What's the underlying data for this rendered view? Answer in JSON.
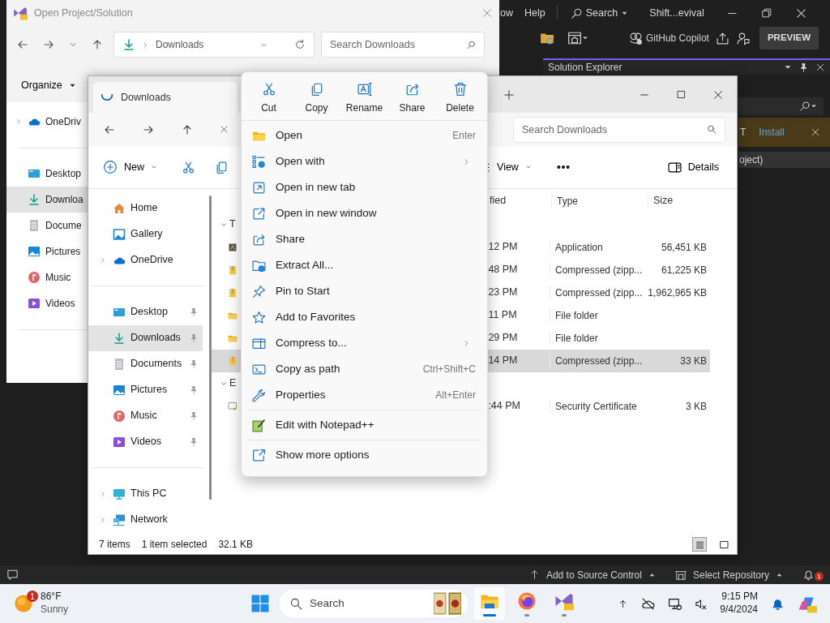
{
  "ide": {
    "menu": [
      {
        "label": "ow"
      },
      {
        "label": "Help"
      }
    ],
    "search": "Search",
    "title": "Shift...evival",
    "copilot": "GitHub Copilot",
    "preview": "PREVIEW",
    "solution_explorer": {
      "title": "Solution Explorer",
      "info_text": "T",
      "info_action": "Install",
      "tree_item": "oject)"
    },
    "status_bar": {
      "source_control": "Add to Source Control",
      "repository": "Select Repository",
      "notifications": "1"
    }
  },
  "dialog": {
    "title": "Open Project/Solution",
    "address": "Downloads",
    "search": {
      "placeholder": "Search Downloads"
    },
    "organize": "Organize",
    "nav": [
      [
        {
          "label": "OneDriv",
          "expandable": true,
          "selected": false
        }
      ],
      [
        {
          "label": "Desktop",
          "expandable": false,
          "selected": false
        },
        {
          "label": "Downloa",
          "expandable": false,
          "selected": true
        },
        {
          "label": "Docume",
          "expandable": false,
          "selected": false
        },
        {
          "label": "Pictures",
          "expandable": false,
          "selected": false
        },
        {
          "label": "Music",
          "expandable": false,
          "selected": false
        },
        {
          "label": "Videos",
          "expandable": false,
          "selected": false
        }
      ]
    ]
  },
  "explorer": {
    "tab": "Downloads",
    "search": {
      "placeholder": "Search Downloads"
    },
    "commands": {
      "new": "New",
      "view": "View",
      "details": "Details"
    },
    "sidebar": [
      [
        {
          "label": "Home",
          "expandable": false,
          "pinned": false,
          "selected": false
        },
        {
          "label": "Gallery",
          "expandable": false,
          "pinned": false,
          "selected": false
        },
        {
          "label": "OneDrive",
          "expandable": true,
          "pinned": false,
          "selected": false
        }
      ],
      [
        {
          "label": "Desktop",
          "expandable": false,
          "pinned": true,
          "selected": false
        },
        {
          "label": "Downloads",
          "expandable": false,
          "pinned": true,
          "selected": true
        },
        {
          "label": "Documents",
          "expandable": false,
          "pinned": true,
          "selected": false
        },
        {
          "label": "Pictures",
          "expandable": false,
          "pinned": true,
          "selected": false
        },
        {
          "label": "Music",
          "expandable": false,
          "pinned": true,
          "selected": false
        },
        {
          "label": "Videos",
          "expandable": false,
          "pinned": true,
          "selected": false
        }
      ],
      [
        {
          "label": "This PC",
          "expandable": true,
          "pinned": false,
          "selected": false
        },
        {
          "label": "Network",
          "expandable": true,
          "pinned": false,
          "selected": false
        }
      ]
    ],
    "columns": [
      "fied",
      "Type",
      "Size"
    ],
    "groups": [
      {
        "label": "T",
        "expanded": true,
        "rows": [
          {
            "modified": "12 PM",
            "type": "Application",
            "size": "56,451 KB",
            "selected": false
          },
          {
            "modified": "48 PM",
            "type": "Compressed (zipp...",
            "size": "61,225 KB",
            "selected": false
          },
          {
            "modified": "23 PM",
            "type": "Compressed (zipp...",
            "size": "1,962,965 KB",
            "selected": false
          },
          {
            "modified": "11 PM",
            "type": "File folder",
            "size": "",
            "selected": false
          },
          {
            "modified": "29 PM",
            "type": "File folder",
            "size": "",
            "selected": false
          },
          {
            "modified": "14 PM",
            "type": "Compressed (zipp...",
            "size": "33 KB",
            "selected": true
          }
        ]
      },
      {
        "label": "E",
        "expanded": true,
        "rows": [
          {
            "modified": ":44 PM",
            "type": "Security Certificate",
            "size": "3 KB",
            "selected": false
          }
        ]
      }
    ],
    "status": {
      "count": "7 items",
      "selection": "1 item selected",
      "size": "32.1 KB"
    },
    "views": [
      {
        "selected": true
      },
      {
        "selected": false
      }
    ]
  },
  "context_menu": {
    "actions": [
      {
        "label": "Cut"
      },
      {
        "label": "Copy"
      },
      {
        "label": "Rename"
      },
      {
        "label": "Share"
      },
      {
        "label": "Delete"
      }
    ],
    "sections": [
      [
        {
          "label": "Open",
          "shortcut": "Enter",
          "submenu": false
        },
        {
          "label": "Open with",
          "submenu": true
        },
        {
          "label": "Open in new tab",
          "submenu": false
        },
        {
          "label": "Open in new window",
          "submenu": false
        },
        {
          "label": "Share",
          "submenu": false
        },
        {
          "label": "Extract All...",
          "submenu": false
        },
        {
          "label": "Pin to Start",
          "submenu": false
        },
        {
          "label": "Add to Favorites",
          "submenu": false
        },
        {
          "label": "Compress to...",
          "submenu": true
        },
        {
          "label": "Copy as path",
          "shortcut": "Ctrl+Shift+C",
          "submenu": false
        },
        {
          "label": "Properties",
          "shortcut": "Alt+Enter",
          "submenu": false
        }
      ],
      [
        {
          "label": "Edit with Notepad++",
          "submenu": false
        }
      ],
      [
        {
          "label": "Show more options",
          "submenu": false
        }
      ]
    ]
  },
  "taskbar": {
    "weather": {
      "temperature": "86°F",
      "condition": "Sunny",
      "badge": "1"
    },
    "search": {
      "placeholder": "Search"
    },
    "apps": [
      {
        "selected": true
      },
      {
        "selected": false
      },
      {
        "selected": false
      }
    ],
    "clock": {
      "time": "9:15 PM",
      "date": "9/4/2024"
    }
  }
}
